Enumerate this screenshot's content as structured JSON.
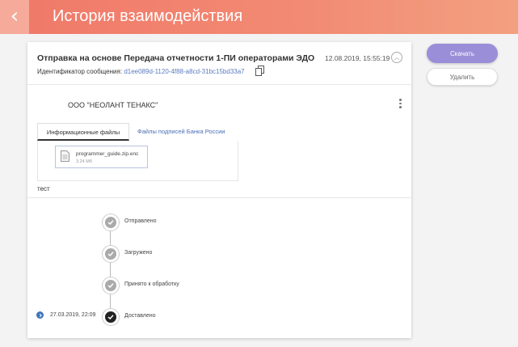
{
  "header": {
    "title": "История взаимодействия",
    "back_icon": "chevron-left-icon"
  },
  "message": {
    "title": "Отправка на основе Передача отчетности 1-ПИ операторами ЭДО",
    "date": "12.08.2019, 15:55:19",
    "id_label": "Идентификатор сообщения:",
    "id_value": "d1ee089d-1120-4f88-a8cd-31bc15bd33a7",
    "organization": "ООО \"НЕОЛАНТ ТЕНАКС\"",
    "note": "тест"
  },
  "tabs": [
    {
      "label": "Информационные файлы",
      "active": true
    },
    {
      "label": "Файлы подписей Банка России",
      "active": false
    }
  ],
  "file": {
    "name": "programmer_guide.zip.enc",
    "size": "3.24 Мб"
  },
  "timeline": [
    {
      "label": "Отправлено",
      "done": true
    },
    {
      "label": "Загружено",
      "done": true
    },
    {
      "label": "Принято к обработку",
      "done": true
    },
    {
      "label": "Доставлено",
      "done": true,
      "current": true,
      "date": "27.03.2019, 22:09"
    }
  ],
  "actions": {
    "download": "Скачать",
    "delete": "Удалить"
  },
  "colors": {
    "accent": "#9b8ed8",
    "header": "#f07868",
    "link": "#5b7cc0"
  }
}
